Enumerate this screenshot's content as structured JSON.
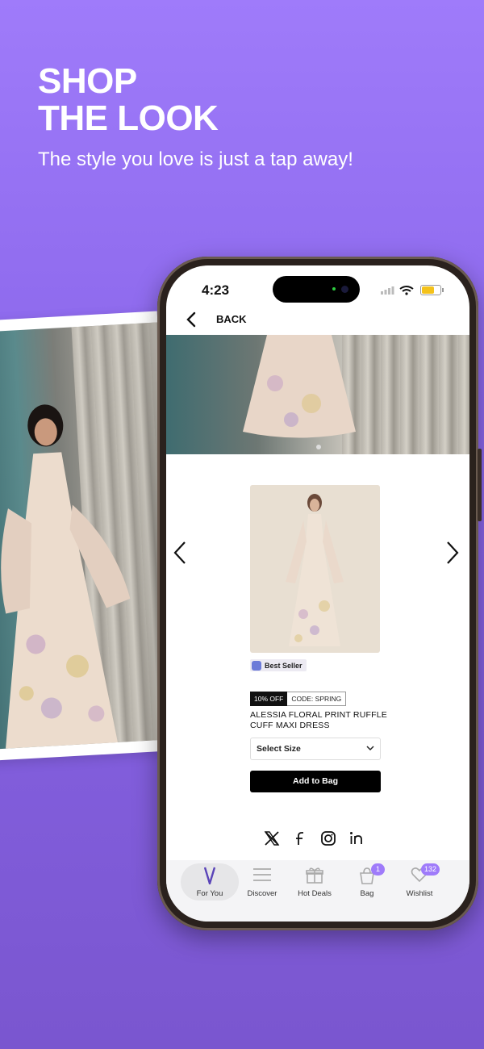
{
  "promo": {
    "headline_line1": "SHOP",
    "headline_line2": "THE LOOK",
    "subheading": "The style you love is just a tap away!"
  },
  "status_bar": {
    "time": "4:23"
  },
  "header": {
    "back_label": "BACK"
  },
  "product": {
    "badge": "Best Seller",
    "discount": "10% OFF",
    "code": "CODE: SPRING",
    "name": "ALESSIA FLORAL PRINT RUFFLE CUFF MAXI DRESS",
    "size_select": "Select Size",
    "add_to_bag": "Add to Bag"
  },
  "social": [
    "x-icon",
    "facebook-icon",
    "instagram-icon",
    "linkedin-icon"
  ],
  "tabs": [
    {
      "label": "For You",
      "icon": "brand-v-icon",
      "active": true
    },
    {
      "label": "Discover",
      "icon": "menu-icon"
    },
    {
      "label": "Hot Deals",
      "icon": "gift-icon"
    },
    {
      "label": "Bag",
      "icon": "bag-icon",
      "count": "1"
    },
    {
      "label": "Wishlist",
      "icon": "heart-icon",
      "count": "132"
    }
  ],
  "colors": {
    "background": "#9f7bfa",
    "accent": "#9f7bfa",
    "button": "#000000"
  }
}
